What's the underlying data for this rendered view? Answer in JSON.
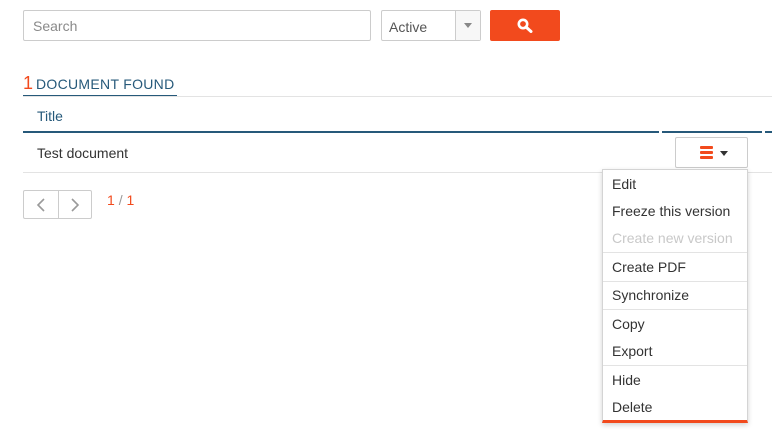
{
  "toolbar": {
    "search_placeholder": "Search",
    "status_value": "Active",
    "search_button_icon": "search-icon",
    "accent_color": "#f24a1d"
  },
  "results": {
    "count": "1",
    "label": "DOCUMENT FOUND"
  },
  "table": {
    "columns": [
      "Title"
    ],
    "rows": [
      {
        "title": "Test document",
        "actions_icon": "menu-bars-icon"
      }
    ]
  },
  "pagination": {
    "current": "1",
    "separator": "/",
    "total": "1"
  },
  "row_menu": {
    "items": [
      {
        "label": "Edit",
        "disabled": false
      },
      {
        "label": "Freeze this version",
        "disabled": false
      },
      {
        "label": "Create new version",
        "disabled": true
      },
      {
        "label": "Create PDF",
        "disabled": false
      },
      {
        "label": "Synchronize",
        "disabled": false
      },
      {
        "label": "Copy",
        "disabled": false
      },
      {
        "label": "Export",
        "disabled": false
      },
      {
        "label": "Hide",
        "disabled": false
      },
      {
        "label": "Delete",
        "disabled": false
      }
    ]
  }
}
